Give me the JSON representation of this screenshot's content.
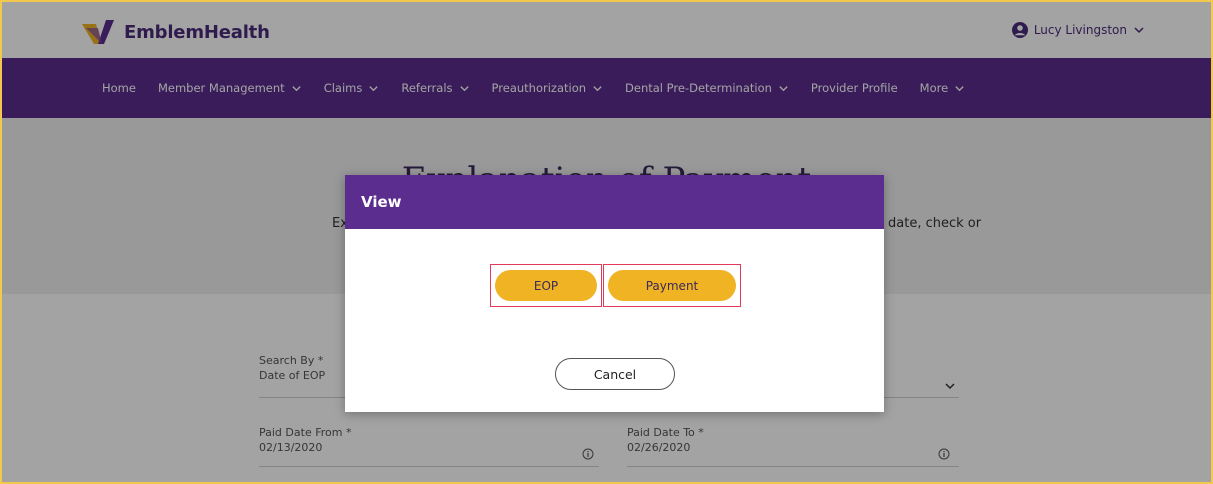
{
  "header": {
    "brand": "EmblemHealth",
    "user_name": "Lucy Livingston"
  },
  "nav": {
    "items": [
      {
        "label": "Home",
        "dropdown": false
      },
      {
        "label": "Member Management",
        "dropdown": true
      },
      {
        "label": "Claims",
        "dropdown": true
      },
      {
        "label": "Referrals",
        "dropdown": true
      },
      {
        "label": "Preauthorization",
        "dropdown": true
      },
      {
        "label": "Dental Pre-Determination",
        "dropdown": true
      },
      {
        "label": "Provider Profile",
        "dropdown": false
      },
      {
        "label": "More",
        "dropdown": true
      }
    ]
  },
  "page": {
    "title": "Explanation of Payment",
    "desc_left": "Ex",
    "desc_right": "date, check or",
    "search_by_label": "Search By *",
    "search_by_value": "Date of EOP",
    "paid_from_label": "Paid Date From  *",
    "paid_from_value": "02/13/2020",
    "paid_to_label": "Paid Date To  *",
    "paid_to_value": "02/26/2020"
  },
  "modal": {
    "title": "View",
    "eop_label": "EOP",
    "payment_label": "Payment",
    "cancel_label": "Cancel"
  },
  "colors": {
    "brand_purple": "#5b2d8e",
    "accent_gold": "#f0b323",
    "highlight_red": "#e23a5a"
  }
}
